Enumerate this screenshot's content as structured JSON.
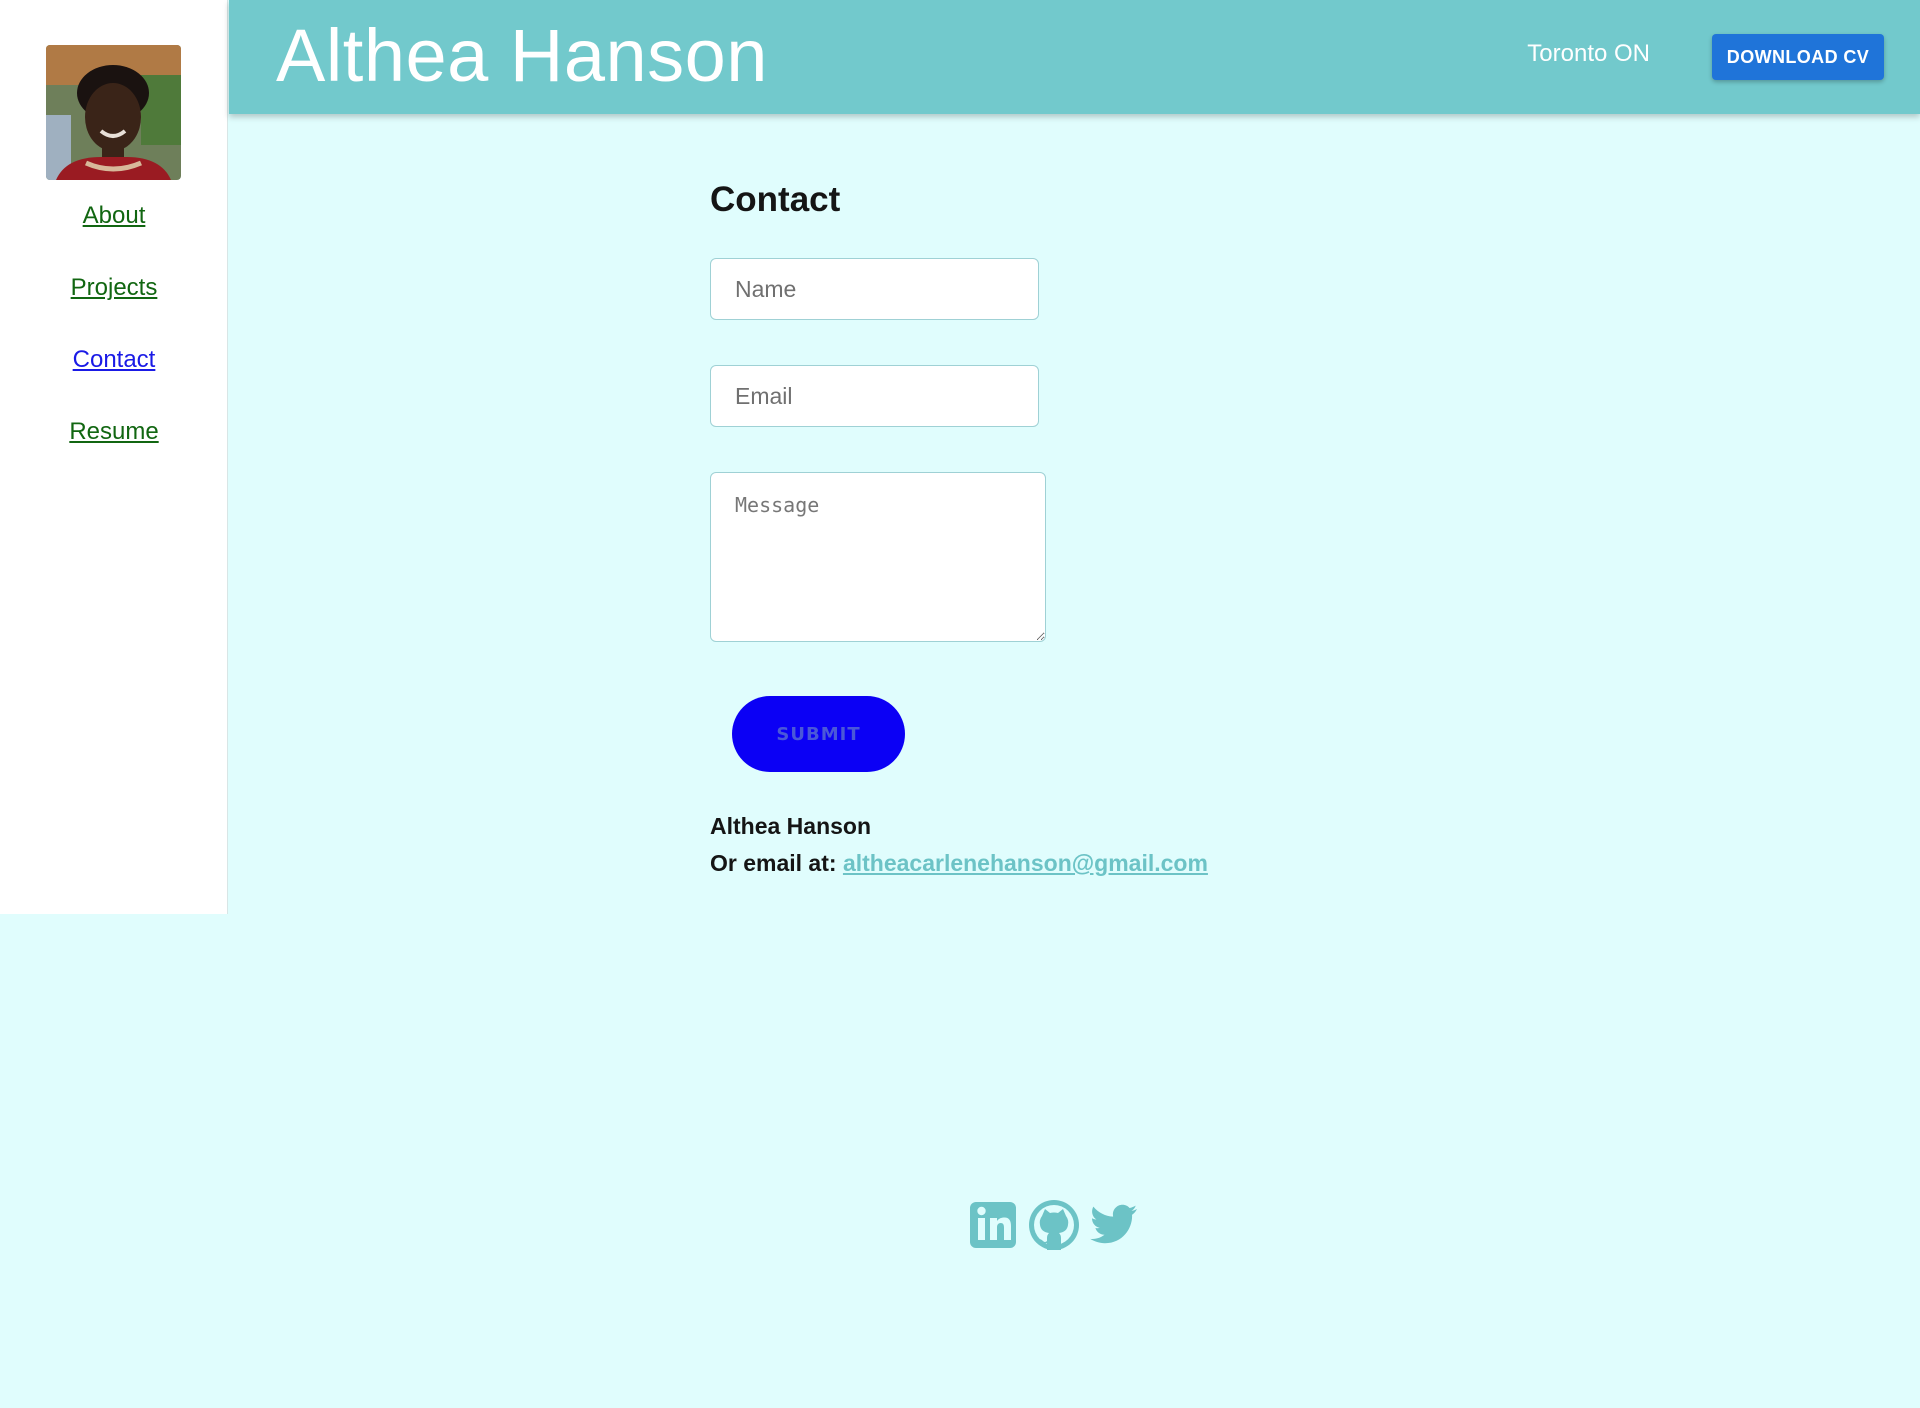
{
  "sidebar": {
    "nav": [
      {
        "label": "About",
        "active": false
      },
      {
        "label": "Projects",
        "active": false
      },
      {
        "label": "Contact",
        "active": true
      },
      {
        "label": "Resume",
        "active": false
      }
    ]
  },
  "header": {
    "name": "Althea Hanson",
    "location": "Toronto ON",
    "cv_button": "DOWNLOAD CV"
  },
  "contact": {
    "title": "Contact",
    "name_placeholder": "Name",
    "email_placeholder": "Email",
    "message_placeholder": "Message",
    "submit_label": "SUBMIT",
    "owner_name": "Althea Hanson",
    "email_prefix": "Or email at:",
    "email": "altheacarlenehanson@gmail.com"
  },
  "social": {
    "icons": [
      "linkedin-icon",
      "github-icon",
      "twitter-icon"
    ]
  },
  "colors": {
    "page_bg": "#e0fdfd",
    "header_bg": "#72c9cc",
    "cv_button_bg": "#1f74d9",
    "submit_bg": "#0b00f5",
    "nav_link": "#116611",
    "nav_active": "#1a1ae6",
    "accent": "#6cc3c6"
  }
}
